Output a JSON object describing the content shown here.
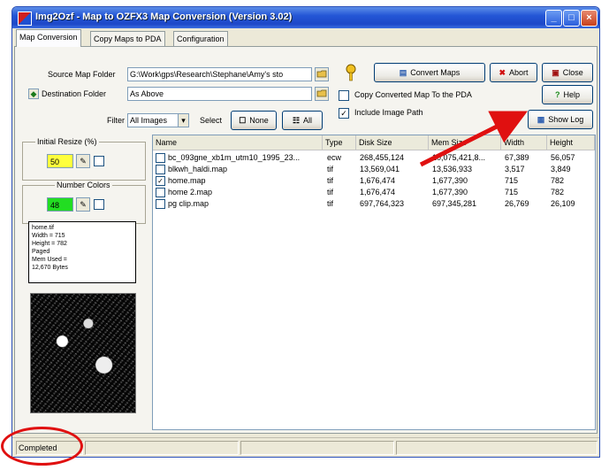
{
  "window": {
    "title": "Img2Ozf - Map to OZFX3 Map Conversion (Version 3.02)",
    "controls": [
      "_",
      "□",
      "×"
    ]
  },
  "tabs": [
    {
      "label": "Map Conversion",
      "active": true
    },
    {
      "label": "Copy Maps to PDA",
      "active": false
    },
    {
      "label": "Configuration",
      "active": false
    }
  ],
  "source": {
    "label": "Source Map Folder",
    "value": "G:\\Work\\gps\\Research\\Stephane\\Amy's sto"
  },
  "destination": {
    "label": "Destination Folder",
    "value": "As Above"
  },
  "filter": {
    "label": "Filter",
    "value": "All Images",
    "select_label": "Select",
    "none_label": "None",
    "all_label": "All"
  },
  "options": {
    "copy_converted": {
      "label": "Copy Converted Map To the PDA",
      "checked": false
    },
    "include_image_path": {
      "label": "Include Image Path",
      "checked": true
    }
  },
  "buttons": {
    "convert": "Convert Maps",
    "abort": "Abort",
    "close": "Close",
    "help": "Help",
    "show_log": "Show Log"
  },
  "initial_resize": {
    "label": "Initial Resize (%)",
    "value": "50"
  },
  "number_colors": {
    "label": "Number Colors",
    "value": "48"
  },
  "file_info": [
    "home.tif",
    "Width = 715",
    "Height = 782",
    "Paged",
    "Mem Used =",
    "12,670 Bytes"
  ],
  "table": {
    "headers": [
      "Name",
      "Type",
      "Disk Size",
      "Mem Size",
      "Width",
      "Height"
    ],
    "rows": [
      {
        "checked": false,
        "name": "bc_093gne_xb1m_utm10_1995_23...",
        "type": "ecw",
        "disk": "268,455,124",
        "mem": "10,075,421,8...",
        "width": "67,389",
        "height": "56,057"
      },
      {
        "checked": false,
        "name": "blkwh_haldi.map",
        "type": "tif",
        "disk": "13,569,041",
        "mem": "13,536,933",
        "width": "3,517",
        "height": "3,849"
      },
      {
        "checked": true,
        "name": "home.map",
        "type": "tif",
        "disk": "1,676,474",
        "mem": "1,677,390",
        "width": "715",
        "height": "782"
      },
      {
        "checked": false,
        "name": "home 2.map",
        "type": "tif",
        "disk": "1,676,474",
        "mem": "1,677,390",
        "width": "715",
        "height": "782"
      },
      {
        "checked": false,
        "name": "pg clip.map",
        "type": "tif",
        "disk": "697,764,323",
        "mem": "697,345,281",
        "width": "26,769",
        "height": "26,109"
      }
    ]
  },
  "status": {
    "text": "Completed"
  },
  "colors": {
    "annotation": "#e01010",
    "resize_bg": "#ffff3c",
    "colors_bg": "#22dd22"
  }
}
